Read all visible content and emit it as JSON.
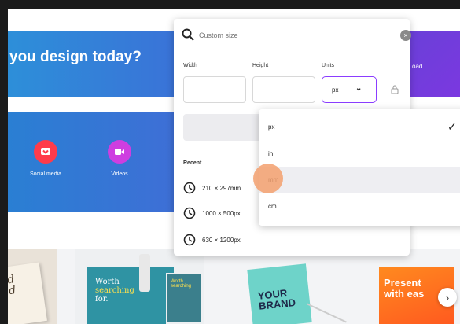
{
  "hero": {
    "title": "you design today?",
    "right_text": "oad"
  },
  "categories": [
    {
      "label": "Social media",
      "icon": "heart-icon",
      "color": "#ff3b4a"
    },
    {
      "label": "Videos",
      "icon": "video-icon",
      "color": "#ce3ee0"
    }
  ],
  "custom_size": {
    "search_placeholder": "Custom size",
    "width_label": "Width",
    "height_label": "Height",
    "units_label": "Units",
    "units_value": "px",
    "recent_label": "Recent",
    "recent": [
      "210 × 297mm",
      "1000 × 500px",
      "630 × 1200px"
    ]
  },
  "units_dropdown": {
    "options": [
      "px",
      "in",
      "mm",
      "cm"
    ],
    "selected": "px",
    "hovered": "mm"
  },
  "templates": {
    "t1_text": "d\nd",
    "t2_text": [
      "Worth",
      "searching",
      "for."
    ],
    "t2_small": "Worth searching",
    "t3_text": [
      "YOUR",
      "BRAND"
    ],
    "t4_text": [
      "Present",
      "with eas"
    ]
  },
  "colors": {
    "accent": "#8b3dff",
    "hero": "#2d8fd9"
  }
}
